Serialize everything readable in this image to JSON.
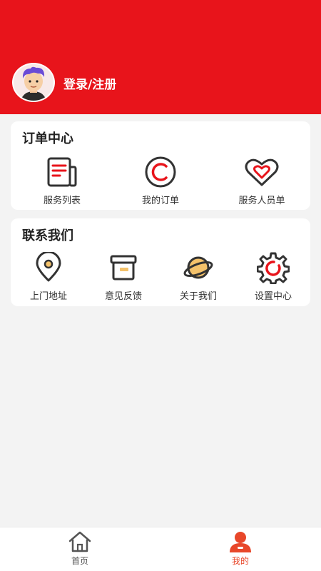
{
  "header": {
    "login_label": "登录/注册",
    "bg_color": "#e8141b"
  },
  "orders": {
    "title": "订单中心",
    "items": [
      {
        "label": "服务列表",
        "icon": "document-list-icon"
      },
      {
        "label": "我的订单",
        "icon": "copyright-circle-icon"
      },
      {
        "label": "服务人员单",
        "icon": "heart-icon"
      }
    ]
  },
  "contact": {
    "title": "联系我们",
    "items": [
      {
        "label": "上门地址",
        "icon": "location-pin-icon"
      },
      {
        "label": "意见反馈",
        "icon": "archive-box-icon"
      },
      {
        "label": "关于我们",
        "icon": "planet-icon"
      },
      {
        "label": "设置中心",
        "icon": "gear-icon"
      }
    ]
  },
  "tabbar": {
    "tabs": [
      {
        "label": "首页",
        "icon": "home-icon",
        "active": false
      },
      {
        "label": "我的",
        "icon": "user-icon",
        "active": true
      }
    ],
    "active_color": "#e8472a",
    "inactive_color": "#555555"
  }
}
